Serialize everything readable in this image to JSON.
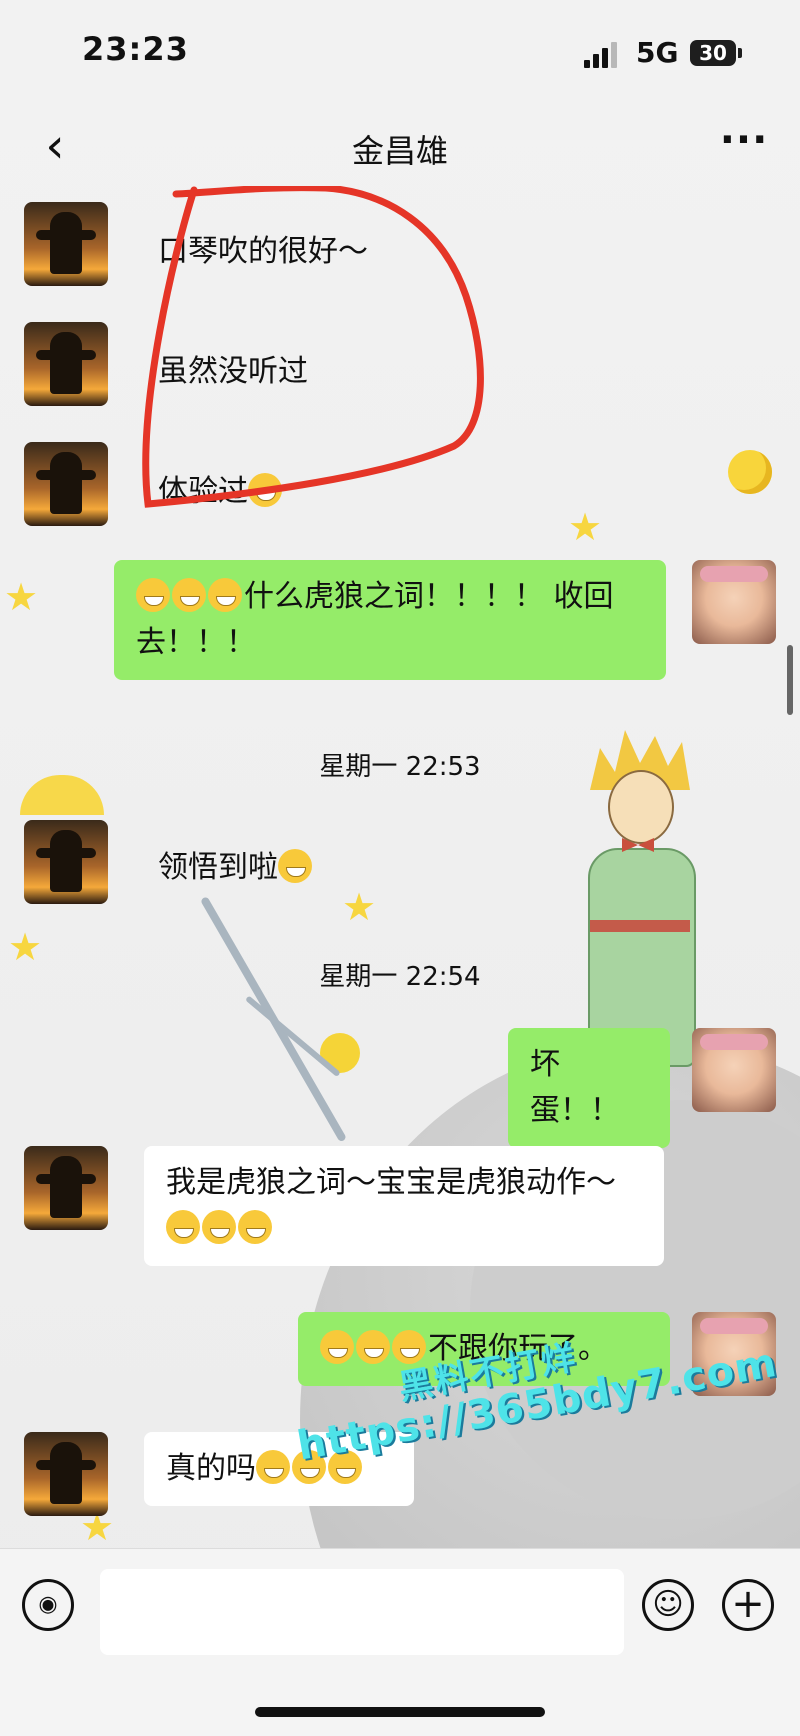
{
  "status_bar": {
    "time": "23:23",
    "network": "5G",
    "battery": "30"
  },
  "nav": {
    "back_icon": "chevron-left-icon",
    "title": "金昌雄",
    "more_icon": "more-dots-icon"
  },
  "messages": [
    {
      "sender": "peer",
      "text": "口琴吹的很好～"
    },
    {
      "sender": "peer",
      "text": "虽然没听过"
    },
    {
      "sender": "peer",
      "text": "体验过"
    },
    {
      "sender": "self",
      "text": "什么虎狼之词！！！！ 收回去！！！"
    },
    {
      "type": "timestamp",
      "text": "星期一 22:53"
    },
    {
      "sender": "peer",
      "text": "领悟到啦"
    },
    {
      "type": "timestamp",
      "text": "星期一 22:54"
    },
    {
      "sender": "self",
      "text": "坏蛋！！"
    },
    {
      "sender": "peer",
      "text": "我是虎狼之词～宝宝是虎狼动作～"
    },
    {
      "sender": "self",
      "text": "不跟你玩了。"
    },
    {
      "sender": "peer",
      "text": "真的吗"
    }
  ],
  "watermark": {
    "line1": "黑料不打烊",
    "line2": "https://365bdy7.com"
  },
  "input_bar": {
    "voice_icon": "voice-icon",
    "emoji_icon": "emoji-icon",
    "plus_icon": "plus-icon"
  },
  "colors": {
    "self_bubble": "#95ec69",
    "peer_bubble": "#ffffff",
    "annotation": "#e53527"
  }
}
